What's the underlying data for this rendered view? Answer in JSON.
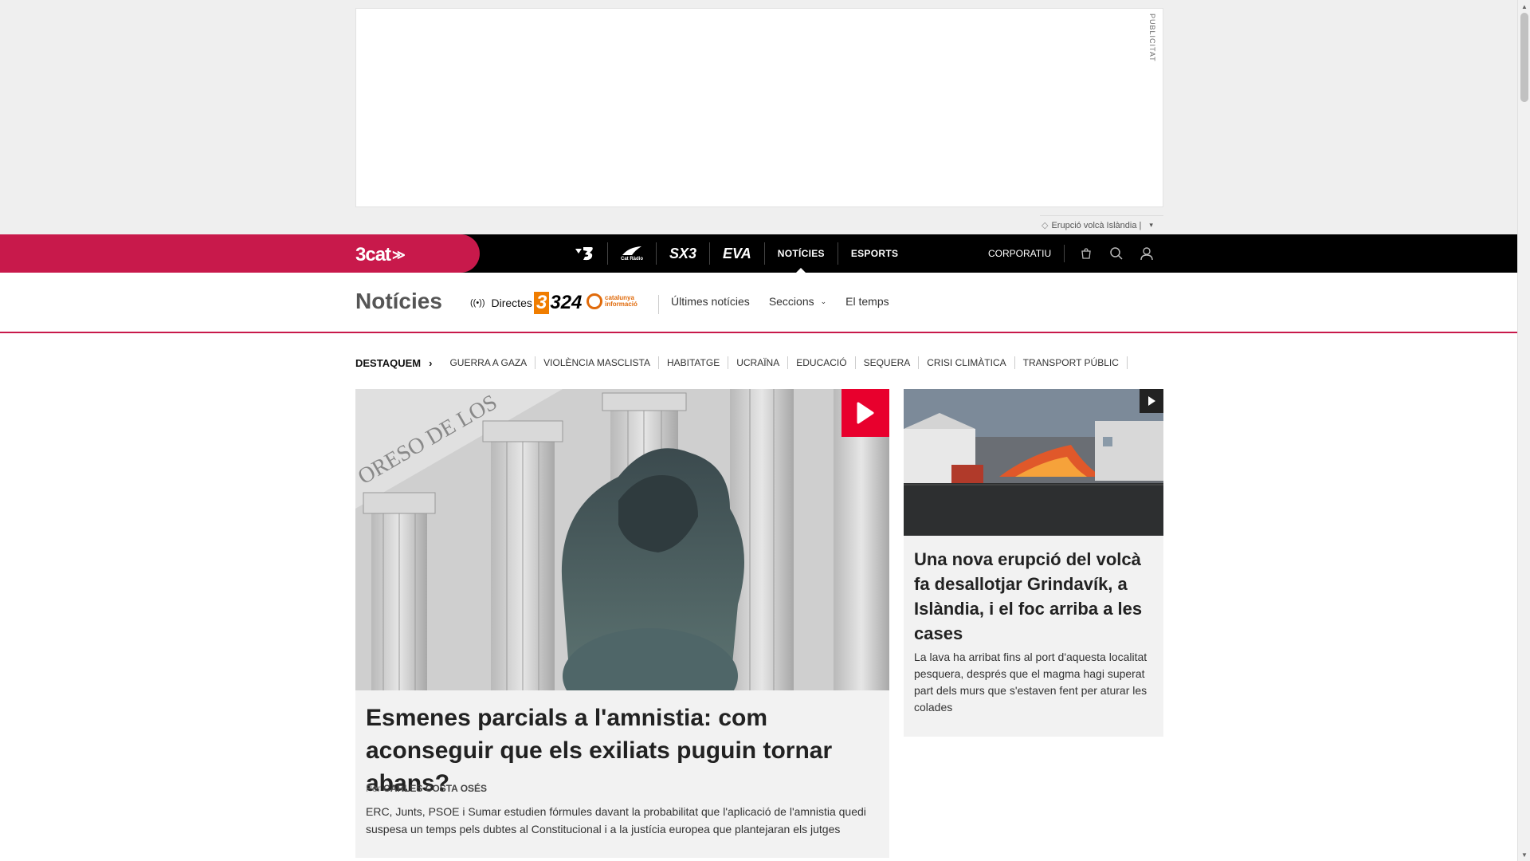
{
  "ad": {
    "label": "PUBLICITAT"
  },
  "trending": {
    "label": "Erupció volcà Islàndia |"
  },
  "topnav": {
    "brand": "3cat",
    "channels": [
      {
        "label": "3",
        "icon": "tv3-logo"
      },
      {
        "label": "Cat Ràdio",
        "icon": "catradio-logo"
      },
      {
        "label": "SX3",
        "icon": "sx3-logo"
      },
      {
        "label": "EVA",
        "icon": "eva-logo"
      },
      {
        "label": "NOTÍCIES"
      },
      {
        "label": "ESPORTS"
      }
    ],
    "corporate": "CORPORATIU"
  },
  "section": {
    "title": "Notícies",
    "directes": "Directes",
    "logo324": "324",
    "logo324_prefix": "3",
    "logocat": "catalunya informació",
    "links": {
      "latest": "Últimes notícies",
      "sections": "Seccions",
      "weather": "El temps"
    }
  },
  "destaquem": {
    "lead": "DESTAQUEM",
    "tags": [
      "GUERRA A GAZA",
      "VIOLÈNCIA MASCLISTA",
      "HABITATGE",
      "UCRAÏNA",
      "EDUCACIÓ",
      "SEQUERA",
      "CRISI CLIMÀTICA",
      "TRANSPORT PÚBLIC"
    ]
  },
  "main_article": {
    "title": "Esmenes parcials a l'amnistia: com aconseguir que els exiliats puguin tornar abans?",
    "by_prefix": "Per",
    "author": "CARLES COSTA OSÉS",
    "summary": "ERC, Junts, PSOE i Sumar estudien fórmules davant la probabilitat que l'aplicació de l'amnistia quedi suspesa un temps pels dubtes al Constitucional i a la justícia europea que plantejaran els jutges",
    "image_text": "ORESO DE LOS"
  },
  "side_article": {
    "title": "Una nova erupció del volcà fa desallotjar Grindavík, a Islàndia, i el foc arriba a les cases",
    "summary": "La lava ha arribat fins al port d'aquesta localitat pesquera, després que el magma hagi superat part dels murs que s'estaven fent per aturar les colades"
  },
  "colors": {
    "brand": "#c8194b",
    "play": "#e8002d",
    "nav": "#000000"
  }
}
